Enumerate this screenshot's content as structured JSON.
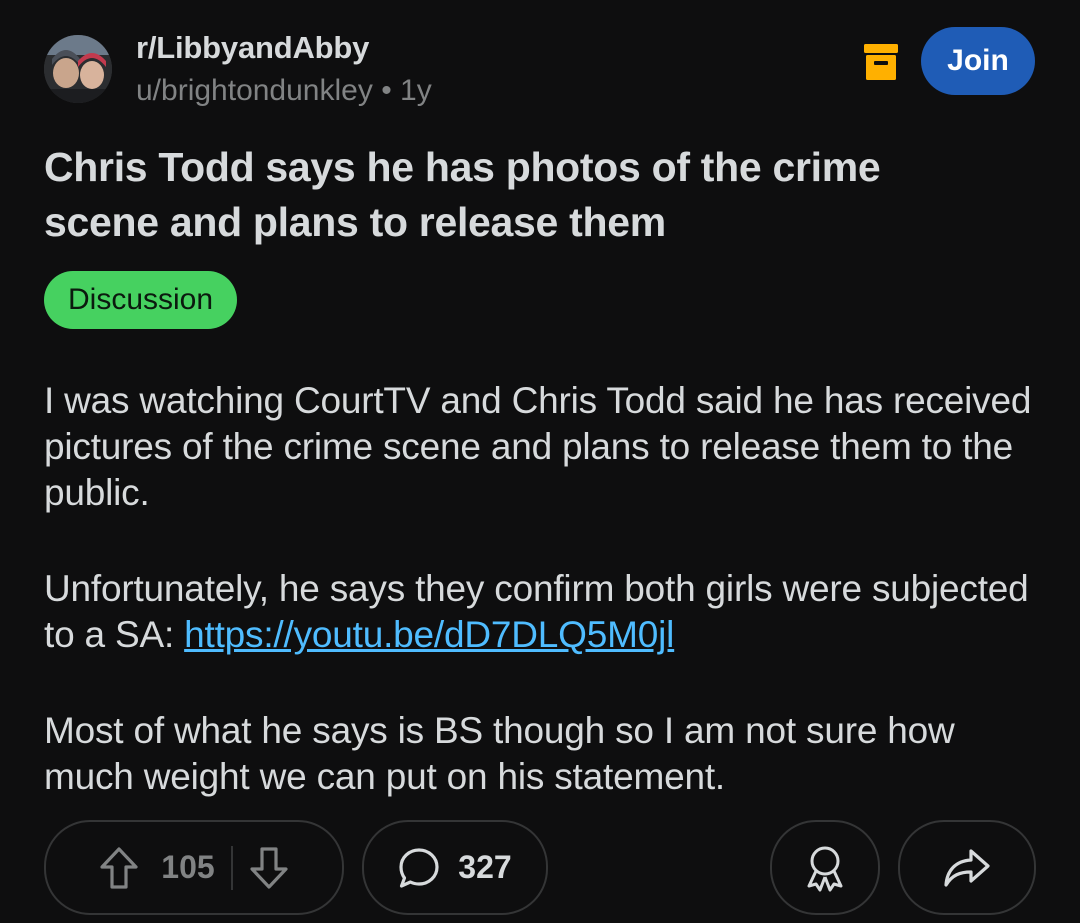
{
  "post": {
    "subreddit": "r/LibbyandAbby",
    "author": "u/brightondunkley",
    "separator": "•",
    "age": "1y",
    "join_label": "Join",
    "title": "Chris Todd says he has photos of the crime scene and plans to release them",
    "flair": "Discussion",
    "body": {
      "paragraph_1": "I was watching CourtTV and Chris Todd said he has received pictures of the crime scene and plans to release them to the public.",
      "paragraph_2_text": "Unfortunately, he says they confirm both girls were subjected to a SA: ",
      "paragraph_2_link": "https://youtu.be/dD7DLQ5M0jl",
      "paragraph_3": "Most of what he says is BS though so I am not sure how much weight we can put on his statement."
    }
  },
  "actions": {
    "upvotes": "105",
    "comments": "327"
  },
  "colors": {
    "background": "#0e0e0f",
    "join_button": "#1f5cb6",
    "flair": "#46d160",
    "link": "#4fbcff",
    "archive_icon": "#ffb000"
  },
  "icons": {
    "archive": "archive-box-icon",
    "upvote": "upvote-arrow-icon",
    "downvote": "downvote-arrow-icon",
    "comment": "speech-bubble-icon",
    "award": "award-ribbon-icon",
    "share": "share-arrow-icon"
  }
}
